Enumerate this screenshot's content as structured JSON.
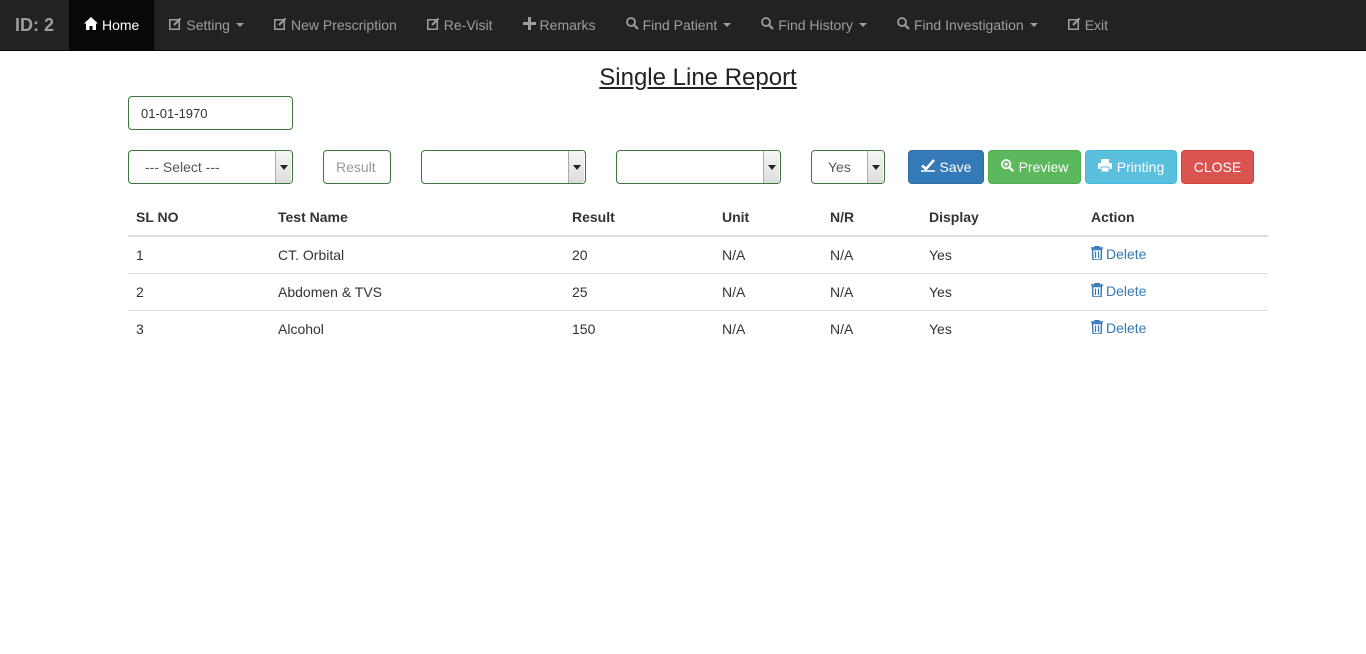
{
  "navbar": {
    "brand": "ID: 2",
    "items": [
      {
        "label": "Home",
        "icon": "home-icon",
        "active": true,
        "dropdown": false
      },
      {
        "label": "Setting",
        "icon": "edit-icon",
        "active": false,
        "dropdown": true
      },
      {
        "label": "New Prescription",
        "icon": "edit-icon",
        "active": false,
        "dropdown": false
      },
      {
        "label": "Re-Visit",
        "icon": "edit-icon",
        "active": false,
        "dropdown": false
      },
      {
        "label": "Remarks",
        "icon": "plus-icon",
        "active": false,
        "dropdown": false
      },
      {
        "label": "Find Patient",
        "icon": "search-icon",
        "active": false,
        "dropdown": true
      },
      {
        "label": "Find History",
        "icon": "search-icon",
        "active": false,
        "dropdown": true
      },
      {
        "label": "Find Investigation",
        "icon": "search-icon",
        "active": false,
        "dropdown": true
      },
      {
        "label": "Exit",
        "icon": "edit-icon",
        "active": false,
        "dropdown": false
      }
    ]
  },
  "page": {
    "title": "Single Line Report"
  },
  "form": {
    "date_value": "01-01-1970",
    "test_select": "--- Select ---",
    "result_placeholder": "Result",
    "unit_select": "",
    "nr_select": "",
    "display_select": "Yes"
  },
  "buttons": {
    "save": "Save",
    "preview": "Preview",
    "printing": "Printing",
    "close": "CLOSE"
  },
  "table": {
    "headers": [
      "SL NO",
      "Test Name",
      "Result",
      "Unit",
      "N/R",
      "Display",
      "Action"
    ],
    "rows": [
      {
        "sl": "1",
        "test": "CT. Orbital",
        "result": "20",
        "unit": "N/A",
        "nr": "N/A",
        "display": "Yes",
        "action": "Delete"
      },
      {
        "sl": "2",
        "test": "Abdomen & TVS",
        "result": "25",
        "unit": "N/A",
        "nr": "N/A",
        "display": "Yes",
        "action": "Delete"
      },
      {
        "sl": "3",
        "test": "Alcohol",
        "result": "150",
        "unit": "N/A",
        "nr": "N/A",
        "display": "Yes",
        "action": "Delete"
      }
    ]
  },
  "colors": {
    "navbar_bg": "#222222",
    "field_border": "#3c763d",
    "link": "#337ab7",
    "save": "#337ab7",
    "preview": "#5cb85c",
    "printing": "#5bc0de",
    "close": "#d9534f"
  }
}
